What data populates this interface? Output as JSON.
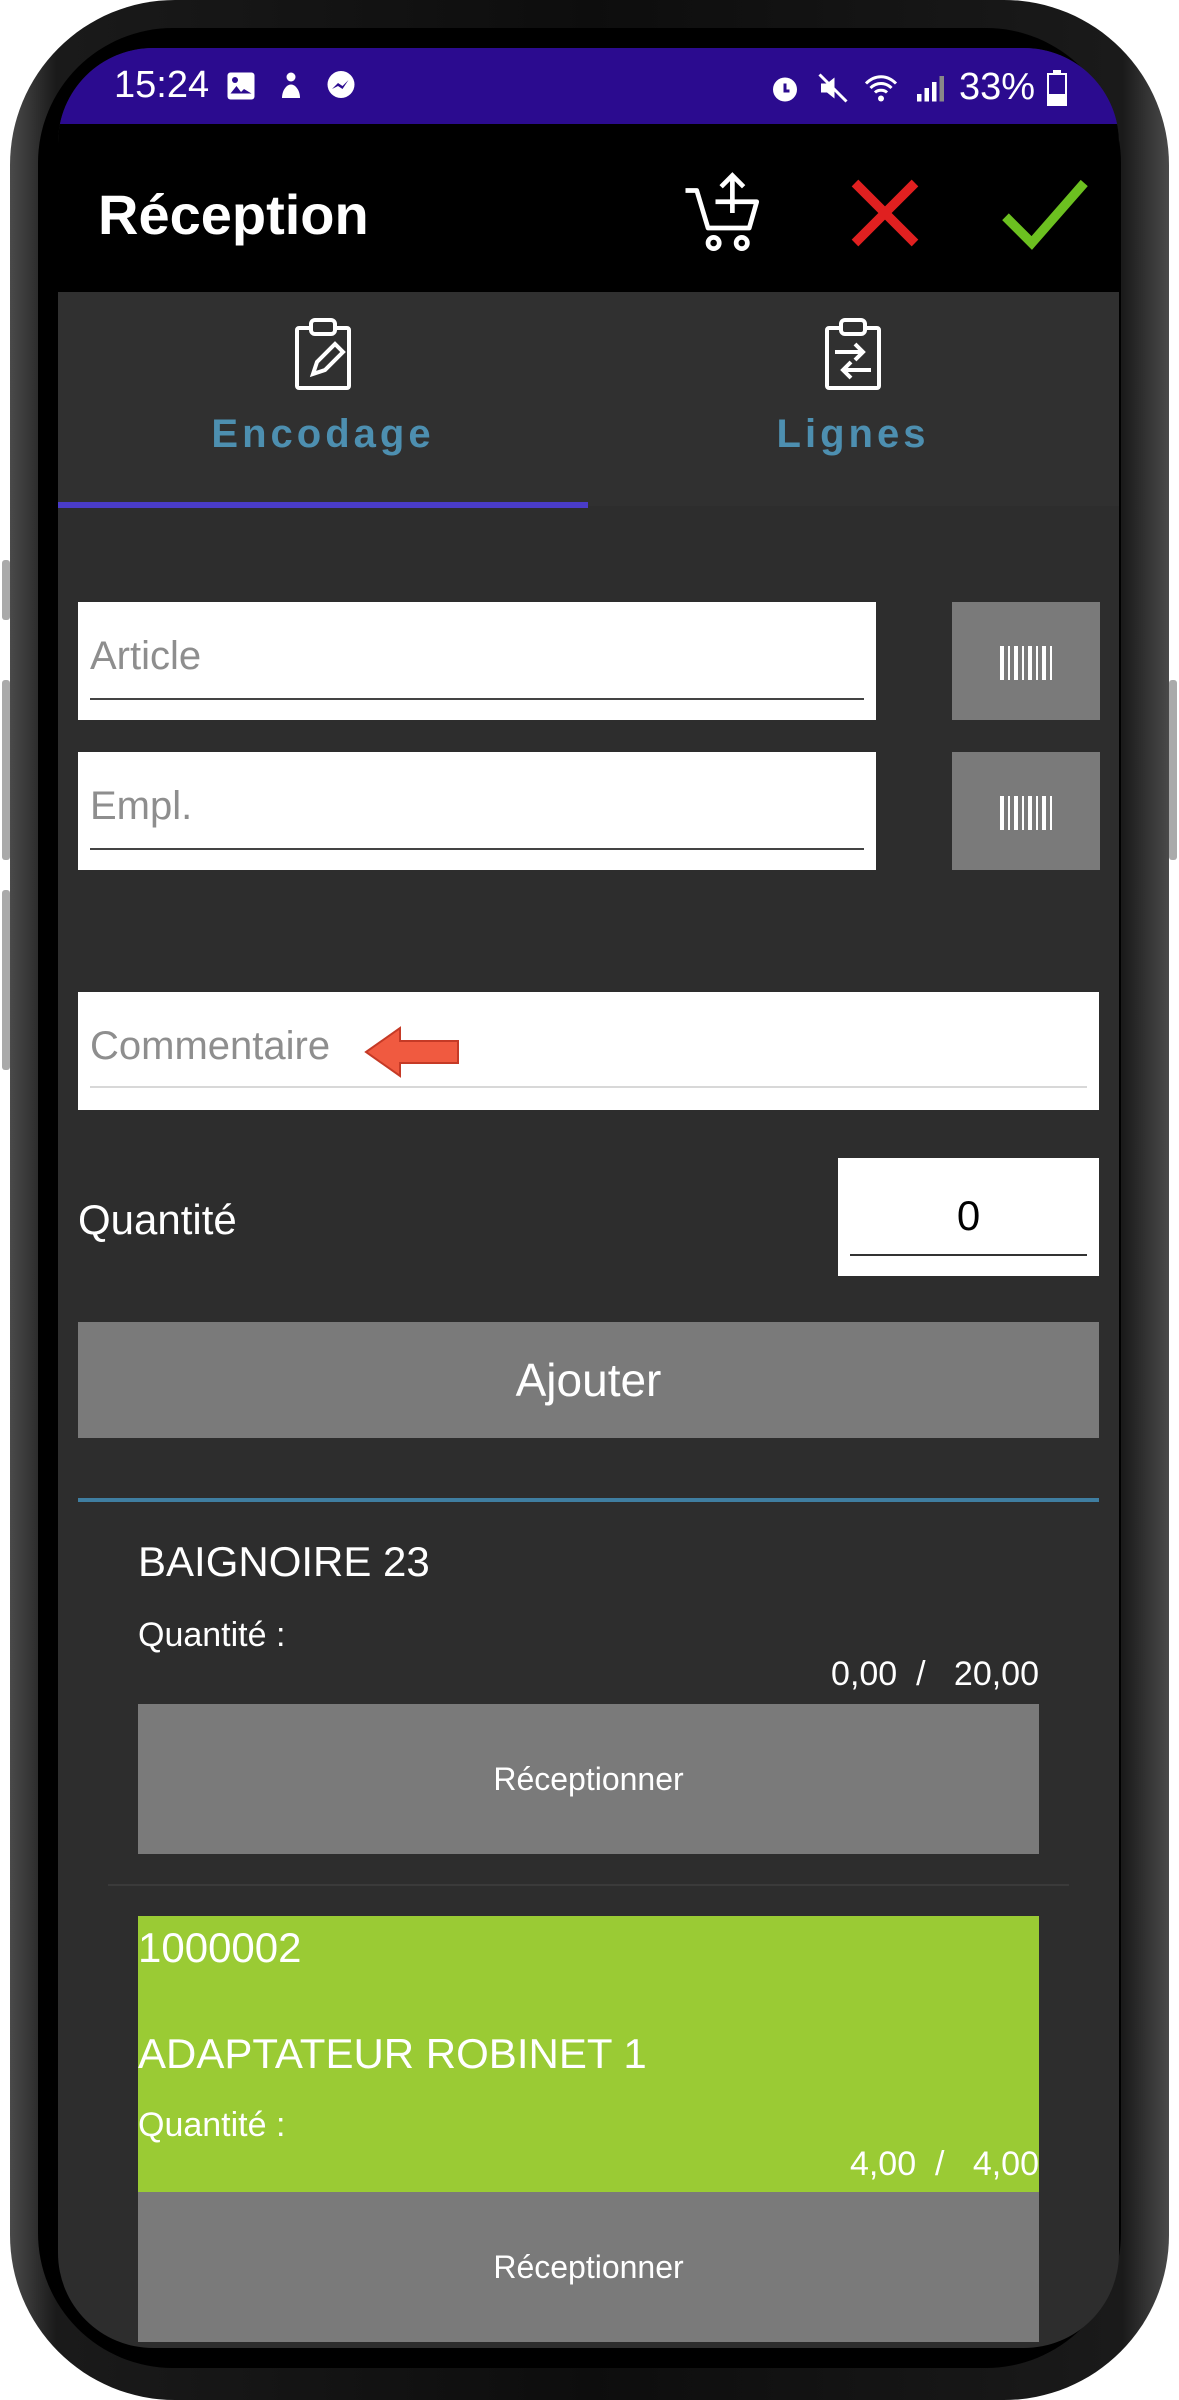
{
  "status_bar": {
    "time": "15:24",
    "battery": "33%",
    "left_icons": [
      "image-icon",
      "android-icon",
      "messenger-icon"
    ],
    "right_icons": [
      "alarm-icon",
      "mute-icon",
      "wifi-icon",
      "signal-icon",
      "battery-icon"
    ]
  },
  "app_bar": {
    "title": "Réception",
    "actions": [
      "cart-upload-icon",
      "close-icon",
      "check-icon"
    ]
  },
  "tabs": [
    {
      "label": "Encodage",
      "icon": "clipboard-edit-icon",
      "selected": true
    },
    {
      "label": "Lignes",
      "icon": "clipboard-transfer-icon",
      "selected": false
    }
  ],
  "form": {
    "article_placeholder": "Article",
    "empl_placeholder": "Empl.",
    "comment_placeholder": "Commentaire",
    "quantity_label": "Quantité",
    "quantity_value": "0",
    "add_button": "Ajouter"
  },
  "lines": [
    {
      "code": "",
      "name": "BAIGNOIRE 23",
      "qty_label": "Quantité :",
      "qty_received": "0,00",
      "qty_expected": "20,00",
      "button": "Réceptionner",
      "highlight": false
    },
    {
      "code": "1000002",
      "name": "ADAPTATEUR ROBINET 1",
      "qty_label": "Quantité :",
      "qty_received": "4,00",
      "qty_expected": "4,00",
      "button": "Réceptionner",
      "highlight": true
    }
  ],
  "colors": {
    "status_bar": "#2b0b8f",
    "accent_tab": "#4d8fb0",
    "tab_indicator": "#4a3cc8",
    "complete_line": "#9acb34",
    "cancel": "#e02020",
    "confirm": "#6cc020"
  }
}
